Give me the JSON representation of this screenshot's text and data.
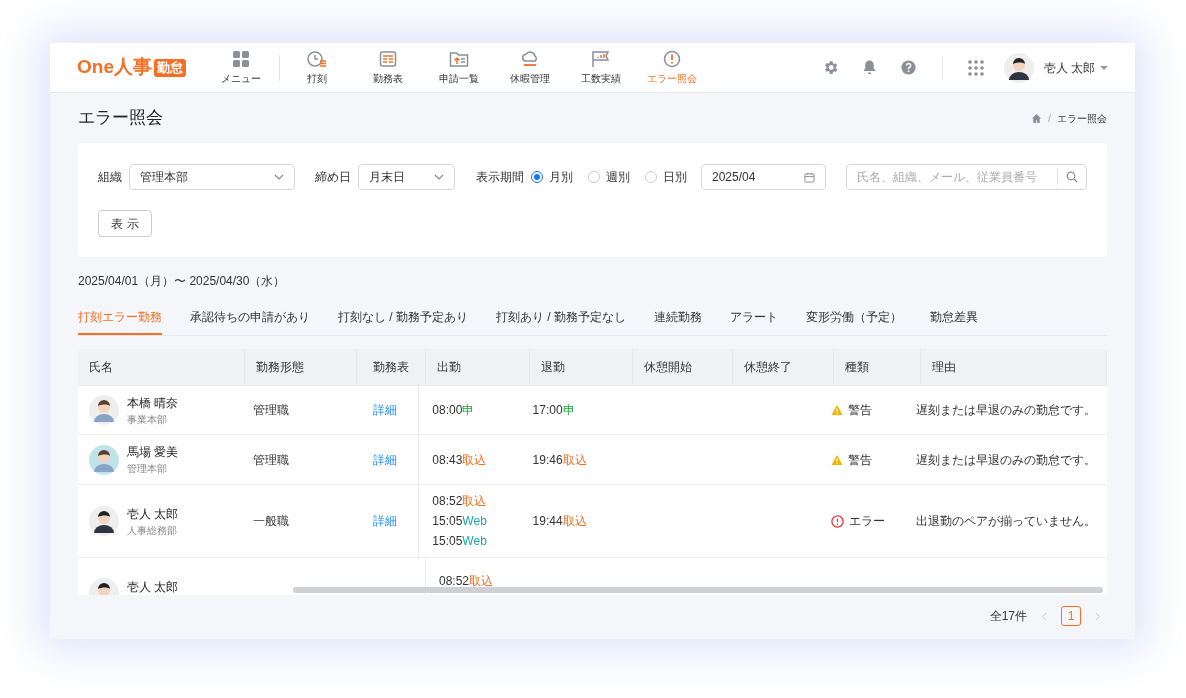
{
  "logo": {
    "text": "One人事",
    "badge": "勤怠"
  },
  "nav": [
    {
      "label": "メニュー",
      "kind": "menu",
      "selected": false
    },
    {
      "label": "打刻",
      "kind": "clock",
      "selected": false
    },
    {
      "label": "勤務表",
      "kind": "sheet",
      "selected": false
    },
    {
      "label": "申請一覧",
      "kind": "request",
      "selected": false
    },
    {
      "label": "休暇管理",
      "kind": "cloud",
      "selected": false
    },
    {
      "label": "工数実績",
      "kind": "flag",
      "selected": false
    },
    {
      "label": "エラー照会",
      "kind": "alert",
      "selected": true
    }
  ],
  "user": {
    "name": "壱人 太郎"
  },
  "page_title": "エラー照会",
  "breadcrumb": {
    "separator": "/",
    "items": [
      "エラー照会"
    ]
  },
  "filters": {
    "organization": {
      "label": "組織",
      "value": "管理本部"
    },
    "closing_day": {
      "label": "締め日",
      "value": "月末日"
    },
    "period": {
      "label": "表示期間",
      "options": [
        {
          "label": "月別",
          "selected": true
        },
        {
          "label": "週別",
          "selected": false
        },
        {
          "label": "日別",
          "selected": false
        }
      ]
    },
    "month": "2025/04",
    "search": {
      "placeholder": "氏名、組織、メール、従業員番号"
    },
    "show_button": "表 示"
  },
  "date_range": "2025/04/01（月）〜 2025/04/30（水）",
  "tabs": [
    {
      "label": "打刻エラー勤務",
      "selected": true
    },
    {
      "label": "承認待ちの申請があり",
      "selected": false
    },
    {
      "label": "打刻なし / 勤務予定あり",
      "selected": false
    },
    {
      "label": "打刻あり / 勤務予定なし",
      "selected": false
    },
    {
      "label": "連続勤務",
      "selected": false
    },
    {
      "label": "アラート",
      "selected": false
    },
    {
      "label": "変形労働（予定）",
      "selected": false
    },
    {
      "label": "勤怠差異",
      "selected": false
    }
  ],
  "table": {
    "columns": [
      "氏名",
      "勤務形態",
      "勤務表",
      "出勤",
      "退勤",
      "休憩開始",
      "休憩終了",
      "種類",
      "理由"
    ],
    "rows": [
      {
        "name": "本橋 晴奈",
        "department": "事業本部",
        "work_type": "管理職",
        "detail": "詳細",
        "clock_in": [
          {
            "time": "08:00",
            "source": "申",
            "kind": "application"
          }
        ],
        "clock_out": [
          {
            "time": "17:00",
            "source": "申",
            "kind": "application"
          }
        ],
        "type": {
          "kind": "warning",
          "label": "警告"
        },
        "reason": "遅刻または早退のみの勤怠です。"
      },
      {
        "name": "馬場 愛美",
        "department": "管理本部",
        "work_type": "管理職",
        "detail": "詳細",
        "clock_in": [
          {
            "time": "08:43",
            "source": "取込",
            "kind": "import"
          }
        ],
        "clock_out": [
          {
            "time": "19:46",
            "source": "取込",
            "kind": "import"
          }
        ],
        "type": {
          "kind": "warning",
          "label": "警告"
        },
        "reason": "遅刻または早退のみの勤怠です。"
      },
      {
        "name": "壱人 太郎",
        "department": "人事総務部",
        "work_type": "一般職",
        "detail": "詳細",
        "clock_in": [
          {
            "time": "08:52",
            "source": "取込",
            "kind": "import"
          },
          {
            "time": "15:05",
            "source": "Web",
            "kind": "web"
          },
          {
            "time": "15:05",
            "source": "Web",
            "kind": "web"
          }
        ],
        "clock_out": [
          {
            "time": "19:44",
            "source": "取込",
            "kind": "import"
          }
        ],
        "type": {
          "kind": "error",
          "label": "エラー"
        },
        "reason": "出退勤のペアが揃っていません。"
      },
      {
        "name": "壱人 太郎",
        "clock_in": [
          {
            "time": "08:52",
            "source": "取込",
            "kind": "import"
          }
        ]
      }
    ]
  },
  "pagination": {
    "total": "全17件",
    "pages": [
      {
        "label": "1",
        "selected": true
      }
    ]
  }
}
